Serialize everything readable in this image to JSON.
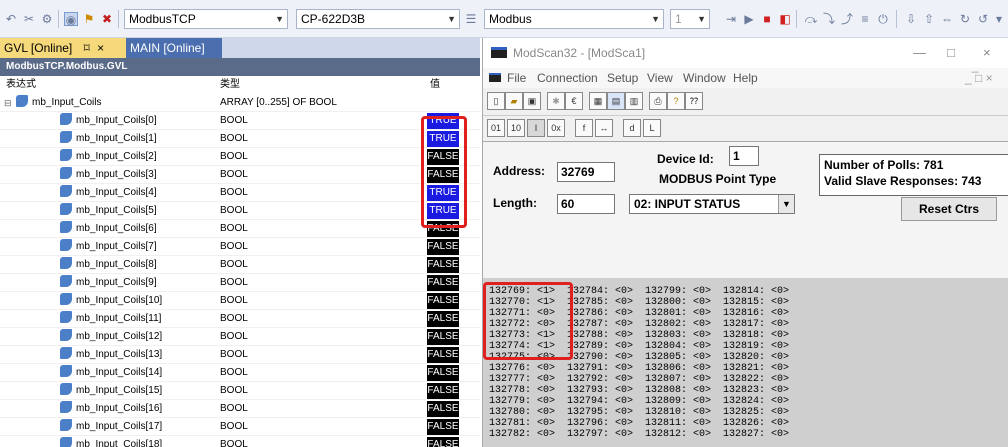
{
  "toolbar": {
    "combo_protocol": "ModbusTCP",
    "combo_device": "CP-622D3B",
    "combo_target": "Modbus",
    "combo_num": "1"
  },
  "gvl": {
    "tab_active": "GVL [Online]",
    "tab_pin": "⌑",
    "tab_close": "×",
    "tab_inactive": "MAIN [Online]",
    "header": "ModbusTCP.Modbus.GVL",
    "col_expr": "表达式",
    "col_type": "类型",
    "col_value": "值",
    "parent_name": "mb_Input_Coils",
    "parent_type": "ARRAY [0..255] OF BOOL",
    "rows": [
      {
        "name": "mb_Input_Coils[0]",
        "type": "BOOL",
        "value": "TRUE"
      },
      {
        "name": "mb_Input_Coils[1]",
        "type": "BOOL",
        "value": "TRUE"
      },
      {
        "name": "mb_Input_Coils[2]",
        "type": "BOOL",
        "value": "FALSE"
      },
      {
        "name": "mb_Input_Coils[3]",
        "type": "BOOL",
        "value": "FALSE"
      },
      {
        "name": "mb_Input_Coils[4]",
        "type": "BOOL",
        "value": "TRUE"
      },
      {
        "name": "mb_Input_Coils[5]",
        "type": "BOOL",
        "value": "TRUE"
      },
      {
        "name": "mb_Input_Coils[6]",
        "type": "BOOL",
        "value": "FALSE"
      },
      {
        "name": "mb_Input_Coils[7]",
        "type": "BOOL",
        "value": "FALSE"
      },
      {
        "name": "mb_Input_Coils[8]",
        "type": "BOOL",
        "value": "FALSE"
      },
      {
        "name": "mb_Input_Coils[9]",
        "type": "BOOL",
        "value": "FALSE"
      },
      {
        "name": "mb_Input_Coils[10]",
        "type": "BOOL",
        "value": "FALSE"
      },
      {
        "name": "mb_Input_Coils[11]",
        "type": "BOOL",
        "value": "FALSE"
      },
      {
        "name": "mb_Input_Coils[12]",
        "type": "BOOL",
        "value": "FALSE"
      },
      {
        "name": "mb_Input_Coils[13]",
        "type": "BOOL",
        "value": "FALSE"
      },
      {
        "name": "mb_Input_Coils[14]",
        "type": "BOOL",
        "value": "FALSE"
      },
      {
        "name": "mb_Input_Coils[15]",
        "type": "BOOL",
        "value": "FALSE"
      },
      {
        "name": "mb_Input_Coils[16]",
        "type": "BOOL",
        "value": "FALSE"
      },
      {
        "name": "mb_Input_Coils[17]",
        "type": "BOOL",
        "value": "FALSE"
      },
      {
        "name": "mb_Input_Coils[18]",
        "type": "BOOL",
        "value": "FALSE"
      }
    ],
    "colors": {
      "true_bg": "#1a1ae0",
      "false_bg": "#000000",
      "highlight": "#e02020"
    }
  },
  "modscan": {
    "title": "ModScan32 - [ModSca1]",
    "minimize": "—",
    "maximize": "□",
    "close": "×",
    "menu": [
      "File",
      "Connection",
      "Setup",
      "View",
      "Window",
      "Help"
    ],
    "child_controls": "_ ̅□ ×",
    "address_label": "Address:",
    "address_value": "32769",
    "device_id_label": "Device Id:",
    "device_id_value": "1",
    "point_type_label": "MODBUS Point Type",
    "length_label": "Length:",
    "length_value": "60",
    "point_type_value": "02: INPUT STATUS",
    "polls_label": "Number of Polls: 781",
    "valid_label": "Valid Slave Responses: 743",
    "reset_label": "Reset Ctrs",
    "data_lines": [
      "132769: <1>  132784: <0>  132799: <0>  132814: <0>",
      "132770: <1>  132785: <0>  132800: <0>  132815: <0>",
      "132771: <0>  132786: <0>  132801: <0>  132816: <0>",
      "132772: <0>  132787: <0>  132802: <0>  132817: <0>",
      "132773: <1>  132788: <0>  132803: <0>  132818: <0>",
      "132774: <1>  132789: <0>  132804: <0>  132819: <0>",
      "132775: <0>  132790: <0>  132805: <0>  132820: <0>",
      "132776: <0>  132791: <0>  132806: <0>  132821: <0>",
      "132777: <0>  132792: <0>  132807: <0>  132822: <0>",
      "132778: <0>  132793: <0>  132808: <0>  132823: <0>",
      "132779: <0>  132794: <0>  132809: <0>  132824: <0>",
      "132780: <0>  132795: <0>  132810: <0>  132825: <0>",
      "132781: <0>  132796: <0>  132811: <0>  132826: <0>",
      "132782: <0>  132797: <0>  132812: <0>  132827: <0>"
    ]
  }
}
